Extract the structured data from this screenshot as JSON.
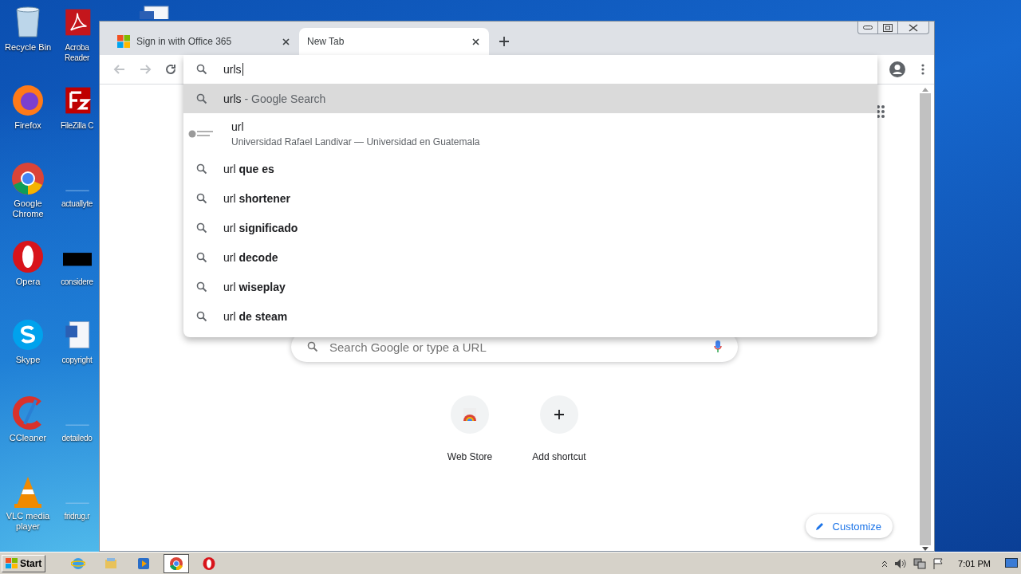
{
  "desktop": {
    "columns": [
      {
        "icons": [
          {
            "label": "Recycle Bin",
            "kind": "recycle"
          },
          {
            "label": "Firefox",
            "kind": "firefox"
          },
          {
            "label": "Google Chrome",
            "kind": "chrome"
          },
          {
            "label": "Opera",
            "kind": "opera"
          },
          {
            "label": "Skype",
            "kind": "skype"
          },
          {
            "label": "CCleaner",
            "kind": "ccleaner"
          },
          {
            "label": "VLC media player",
            "kind": "vlc"
          }
        ]
      },
      {
        "icons": [
          {
            "label": "Acroba Reader",
            "kind": "acrobat"
          },
          {
            "label": "FileZilla C",
            "kind": "filezilla"
          },
          {
            "label": "actuallyte",
            "kind": "blank"
          },
          {
            "label": "considere",
            "kind": "blackbox"
          },
          {
            "label": "copyright",
            "kind": "word"
          },
          {
            "label": "detailedo",
            "kind": "blank"
          },
          {
            "label": "fridrug.r",
            "kind": "blank"
          }
        ]
      },
      {
        "icons": [
          {
            "kind": "word"
          }
        ]
      }
    ]
  },
  "browser": {
    "tabs": [
      {
        "title": "Sign in with Office 365",
        "kind": "microsoft",
        "selected": false
      },
      {
        "title": "New Tab",
        "kind": "none",
        "selected": true
      }
    ],
    "nav": [
      {
        "kind": "back",
        "disabled": true
      },
      {
        "kind": "forward",
        "disabled": true
      },
      {
        "kind": "reload",
        "disabled": false
      }
    ],
    "omnibox": {
      "value": "urls"
    },
    "suggestions": [
      {
        "kind": "search",
        "text": "urls",
        "description": "- Google Search",
        "selected": true
      },
      {
        "kind": "site",
        "text": "url",
        "description": "Universidad Rafael Landivar — Universidad en Guatemala",
        "selected": false
      },
      {
        "kind": "search",
        "text": "url **que es**",
        "selected": false
      },
      {
        "kind": "search",
        "text": "url **shortener**",
        "selected": false
      },
      {
        "kind": "search",
        "text": "url **significado**",
        "selected": false
      },
      {
        "kind": "search",
        "text": "url **decode**",
        "selected": false
      },
      {
        "kind": "search",
        "text": "url **wiseplay**",
        "selected": false
      },
      {
        "kind": "search",
        "text": "url **de steam**",
        "selected": false
      }
    ],
    "new_tab": {
      "search_placeholder": "Search Google or type a URL",
      "shortcuts": [
        {
          "label": "Web Store",
          "kind": "webstore"
        },
        {
          "label": "Add shortcut",
          "kind": "add"
        }
      ],
      "customize": "Customize"
    }
  },
  "taskbar": {
    "start": "Start",
    "apps": [
      {
        "kind": "ie",
        "selected": false
      },
      {
        "kind": "explorer",
        "selected": false
      },
      {
        "kind": "media",
        "selected": false
      },
      {
        "kind": "chrome",
        "selected": true
      },
      {
        "kind": "opera",
        "selected": false
      }
    ],
    "clock": "7:01 PM"
  }
}
